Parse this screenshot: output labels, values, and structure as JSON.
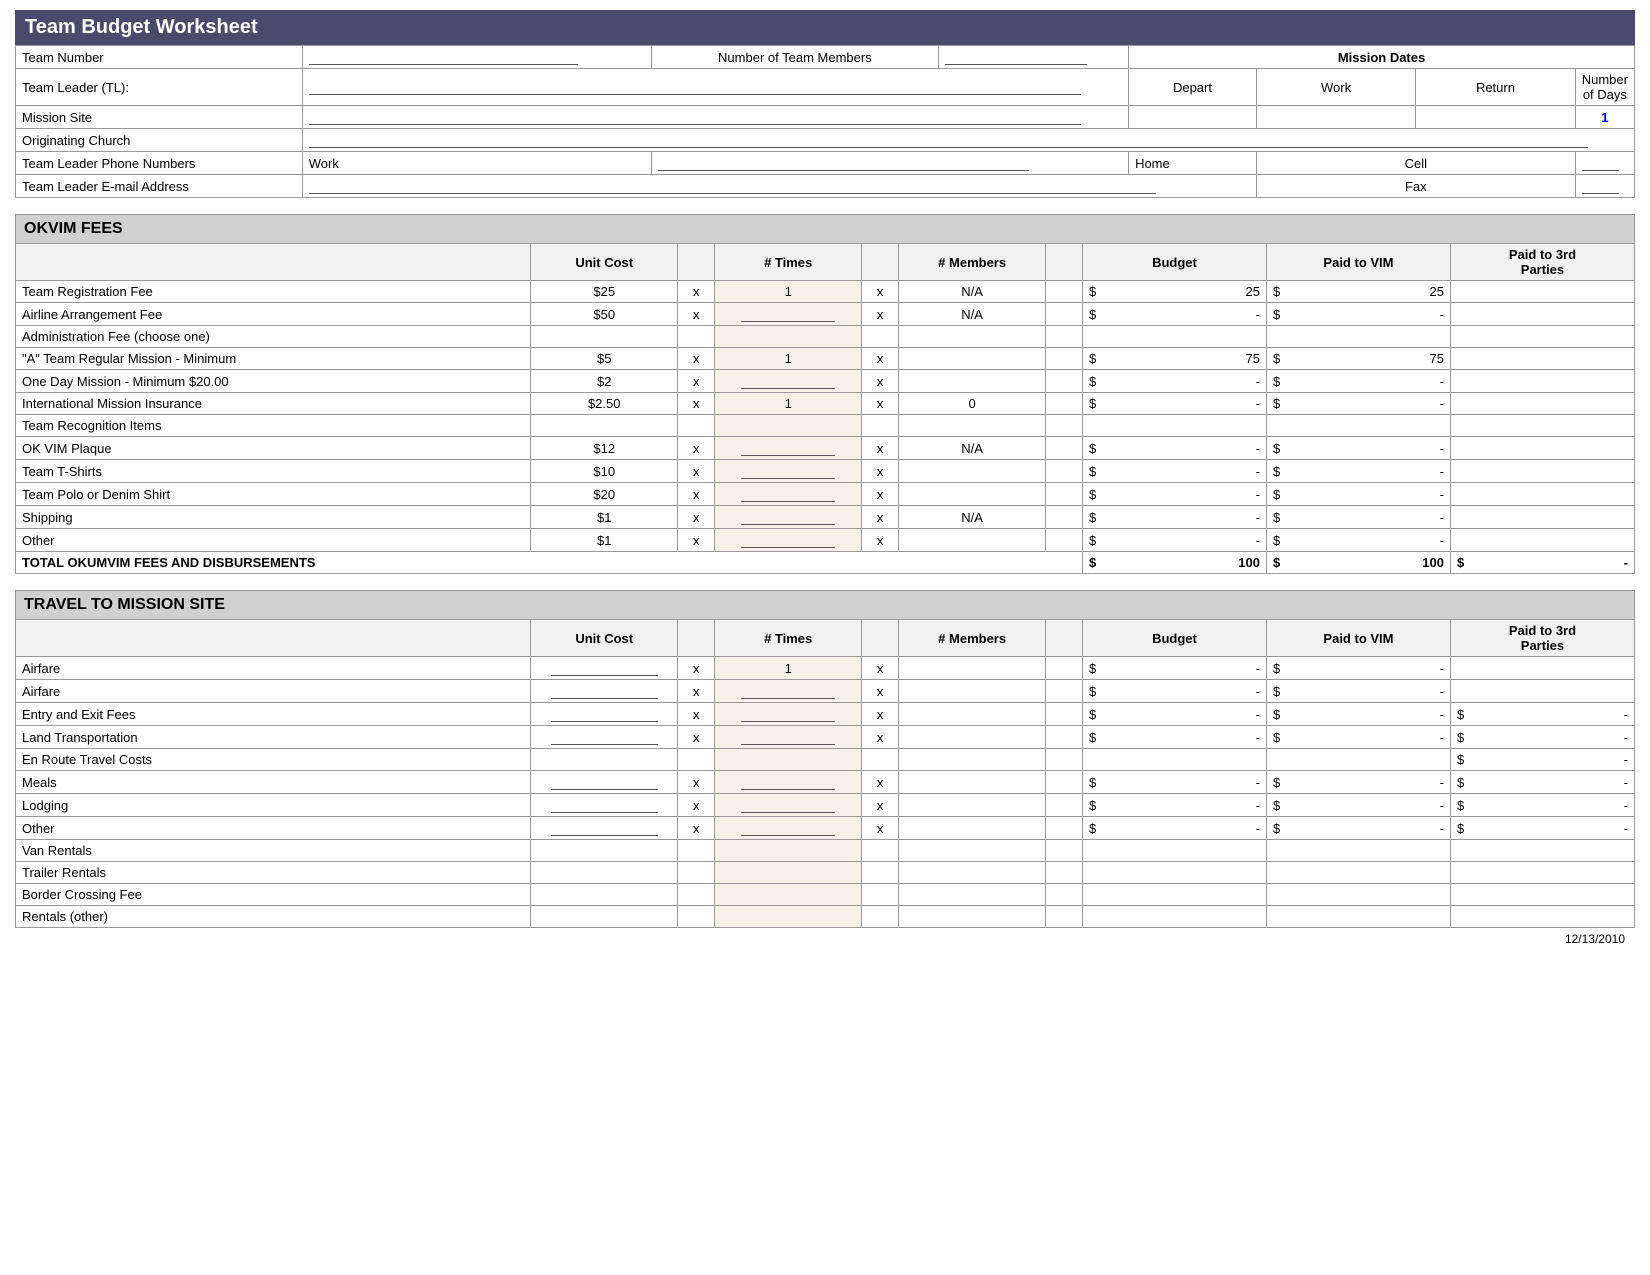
{
  "title": "Team Budget Worksheet",
  "header": {
    "team_number_label": "Team Number",
    "num_members_label": "Number of Team Members",
    "mission_dates_label": "Mission  Dates",
    "team_leader_label": "Team Leader (TL):",
    "depart_label": "Depart",
    "work_label": "Work",
    "return_label": "Return",
    "num_days_label": "Number of Days",
    "num_days_value": "1",
    "mission_site_label": "Mission Site",
    "originating_church_label": "Originating Church",
    "phone_label": "Team Leader Phone Numbers",
    "work_ph_label": "Work",
    "home_ph_label": "Home",
    "cell_ph_label": "Cell",
    "email_label": "Team Leader E-mail Address",
    "fax_label": "Fax"
  },
  "okvim": {
    "section_title": "OKVIM FEES",
    "col_unit": "Unit Cost",
    "col_times": "# Times",
    "col_members": "# Members",
    "col_budget": "Budget",
    "col_vim": "Paid to VIM",
    "col_paid3rd": "Paid to 3rd\nParties",
    "rows": [
      {
        "desc": "Team Registration Fee",
        "unit": "$25",
        "times": "1",
        "members": "N/A",
        "budget": "25",
        "vim": "25",
        "paid3rd": ""
      },
      {
        "desc": "Airline Arrangement Fee",
        "unit": "$50",
        "times": "",
        "members": "N/A",
        "budget": "-",
        "vim": "-",
        "paid3rd": ""
      },
      {
        "desc": "Administration Fee (choose one)",
        "unit": "",
        "times": "",
        "members": "",
        "budget": "",
        "vim": "",
        "paid3rd": ""
      },
      {
        "desc": "\"A\" Team Regular   Mission - Minimum",
        "unit": "$5",
        "times": "1",
        "members": "",
        "budget": "75",
        "vim": "75",
        "paid3rd": ""
      },
      {
        "desc": "  One Day Mission - Minimum $20.00",
        "unit": "$2",
        "times": "",
        "members": "",
        "budget": "-",
        "vim": "-",
        "paid3rd": ""
      },
      {
        "desc": "International Mission Insurance",
        "unit": "$2.50",
        "times": "1",
        "members": "0",
        "budget": "-",
        "vim": "-",
        "paid3rd": ""
      },
      {
        "desc": "Team Recognition Items",
        "unit": "",
        "times": "",
        "members": "",
        "budget": "",
        "vim": "",
        "paid3rd": ""
      },
      {
        "desc": "  OK VIM Plaque",
        "unit": "$12",
        "times": "",
        "members": "N/A",
        "budget": "-",
        "vim": "-",
        "paid3rd": ""
      },
      {
        "desc": "  Team T-Shirts",
        "unit": "$10",
        "times": "",
        "members": "",
        "budget": "-",
        "vim": "-",
        "paid3rd": ""
      },
      {
        "desc": "  Team Polo or Denim Shirt",
        "unit": "$20",
        "times": "",
        "members": "",
        "budget": "-",
        "vim": "-",
        "paid3rd": ""
      },
      {
        "desc": "  Shipping",
        "unit": "$1",
        "times": "",
        "members": "N/A",
        "budget": "-",
        "vim": "-",
        "paid3rd": ""
      },
      {
        "desc": "  Other",
        "unit": "$1",
        "times": "",
        "members": "",
        "budget": "-",
        "vim": "-",
        "paid3rd": ""
      }
    ],
    "total_row": {
      "desc": "TOTAL OKUMVIM FEES AND DISBURSEMENTS",
      "budget": "100",
      "vim": "100",
      "paid3rd": "-"
    }
  },
  "travel": {
    "section_title": "TRAVEL TO MISSION SITE",
    "col_unit": "Unit Cost",
    "col_times": "# Times",
    "col_members": "# Members",
    "col_budget": "Budget",
    "col_vim": "Paid to VIM",
    "col_paid3rd": "Paid to 3rd\nParties",
    "rows": [
      {
        "desc": "Airfare",
        "unit": "",
        "times": "1",
        "members": "",
        "budget": "-",
        "vim": "-",
        "paid3rd": "",
        "show_x": true
      },
      {
        "desc": "Airfare",
        "unit": "",
        "times": "",
        "members": "",
        "budget": "-",
        "vim": "-",
        "paid3rd": "",
        "show_x": true
      },
      {
        "desc": "Entry and Exit Fees",
        "unit": "",
        "times": "",
        "members": "",
        "budget": "-",
        "vim": "-",
        "paid3rd": "-",
        "show_x": true
      },
      {
        "desc": "Land Transportation",
        "unit": "",
        "times": "",
        "members": "",
        "budget": "-",
        "vim": "-",
        "paid3rd": "-",
        "show_x": true
      },
      {
        "desc": "En Route Travel Costs",
        "unit": "",
        "times": "",
        "members": "",
        "budget": "",
        "vim": "",
        "paid3rd": "-",
        "show_x": false
      },
      {
        "desc": "   Meals",
        "unit": "",
        "times": "",
        "members": "",
        "budget": "-",
        "vim": "-",
        "paid3rd": "-",
        "show_x": true
      },
      {
        "desc": "   Lodging",
        "unit": "",
        "times": "",
        "members": "",
        "budget": "-",
        "vim": "-",
        "paid3rd": "-",
        "show_x": true
      },
      {
        "desc": "   Other",
        "unit": "",
        "times": "",
        "members": "",
        "budget": "-",
        "vim": "-",
        "paid3rd": "-",
        "show_x": true
      },
      {
        "desc": "Van Rentals",
        "unit": "",
        "times": "",
        "members": "",
        "budget": "",
        "vim": "",
        "paid3rd": "",
        "show_x": false
      },
      {
        "desc": "Trailer Rentals",
        "unit": "",
        "times": "",
        "members": "",
        "budget": "",
        "vim": "",
        "paid3rd": "",
        "show_x": false
      },
      {
        "desc": "Border Crossing Fee",
        "unit": "",
        "times": "",
        "members": "",
        "budget": "",
        "vim": "",
        "paid3rd": "",
        "show_x": false
      },
      {
        "desc": "Rentals (other)",
        "unit": "",
        "times": "",
        "members": "",
        "budget": "",
        "vim": "",
        "paid3rd": "",
        "show_x": false
      }
    ]
  },
  "footer": {
    "date": "12/13/2010"
  }
}
